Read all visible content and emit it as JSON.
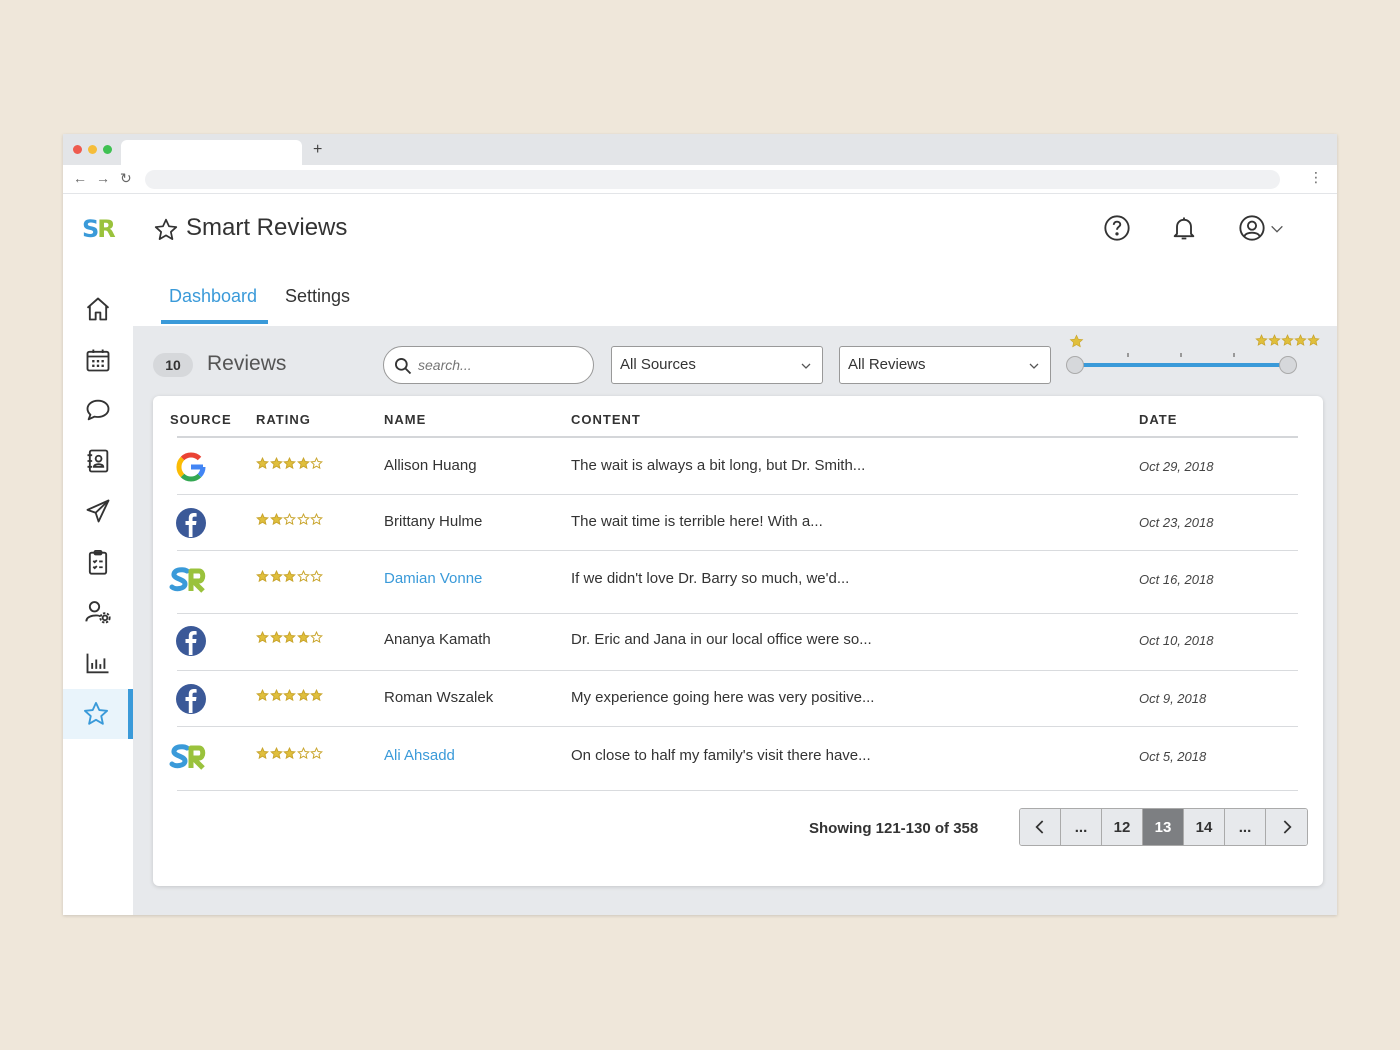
{
  "app": {
    "title": "Smart Reviews",
    "logo_s": "S",
    "logo_r": "R"
  },
  "browser": {
    "new_tab": "+",
    "back": "←",
    "forward": "→",
    "reload": "↻",
    "menu": "⋮"
  },
  "tabs": [
    {
      "label": "Dashboard",
      "active": true
    },
    {
      "label": "Settings",
      "active": false
    }
  ],
  "toolbar": {
    "review_count": "10",
    "reviews_label": "Reviews",
    "search_placeholder": "search...",
    "source_filter": "All Sources",
    "review_filter": "All Reviews",
    "rating_range": {
      "min": 1,
      "max": 5
    }
  },
  "table": {
    "headers": {
      "source": "SOURCE",
      "rating": "RATING",
      "name": "NAME",
      "content": "CONTENT",
      "date": "DATE"
    },
    "rows": [
      {
        "source": "google",
        "rating": 4,
        "name": "Allison Huang",
        "name_is_link": false,
        "content": "The wait is always a bit long, but Dr. Smith...",
        "date": "Oct 29, 2018"
      },
      {
        "source": "facebook",
        "rating": 2,
        "name": "Brittany Hulme",
        "name_is_link": false,
        "content": "The wait time is terrible here! With a...",
        "date": "Oct 23, 2018"
      },
      {
        "source": "smartreviews",
        "rating": 3,
        "name": "Damian Vonne",
        "name_is_link": true,
        "content": "If we didn't love Dr. Barry so much, we'd...",
        "date": "Oct 16, 2018"
      },
      {
        "source": "facebook",
        "rating": 4,
        "name": "Ananya Kamath",
        "name_is_link": false,
        "content": "Dr. Eric and Jana in our local office were so...",
        "date": "Oct 10, 2018"
      },
      {
        "source": "facebook",
        "rating": 5,
        "name": "Roman Wszalek",
        "name_is_link": false,
        "content": "My experience going here was very positive...",
        "date": "Oct 9, 2018"
      },
      {
        "source": "smartreviews",
        "rating": 3,
        "name": "Ali Ahsadd",
        "name_is_link": true,
        "content": "On close to half my family's visit there have...",
        "date": "Oct 5, 2018"
      }
    ]
  },
  "pagination": {
    "showing": "Showing 121-130 of  358",
    "ellipsis_left": "...",
    "pages": [
      "12",
      "13",
      "14"
    ],
    "current": "13",
    "ellipsis_right": "..."
  },
  "colors": {
    "accent": "#3a9ad9",
    "star": "#e0bf3c",
    "logo_green": "#9ac23c",
    "facebook": "#3b5998"
  },
  "icons": {
    "sidebar": [
      "home-icon",
      "calendar-icon",
      "chat-icon",
      "contacts-icon",
      "send-icon",
      "clipboard-icon",
      "user-settings-icon",
      "bar-chart-icon",
      "star-icon"
    ],
    "header": [
      "help-icon",
      "bell-icon",
      "user-account-icon",
      "chevron-down-icon"
    ]
  }
}
